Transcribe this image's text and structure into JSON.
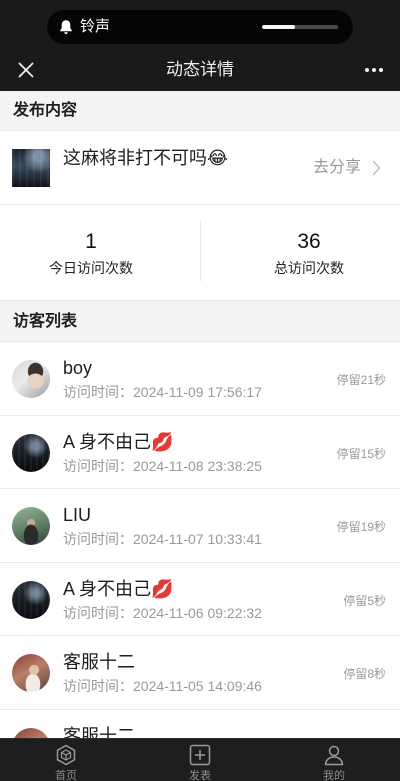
{
  "colors": {
    "bar_bg": "#1a1a1a",
    "page_bg": "#f4f4f4",
    "card_bg": "#ffffff",
    "text_primary": "#222222",
    "text_secondary": "#999999"
  },
  "status_bar": {
    "ringer_icon": "bell-icon",
    "ringer_label": "铃声",
    "ringer_level": 0.43
  },
  "nav": {
    "close_icon": "close-icon",
    "title": "动态详情",
    "more_icon": "more-icon"
  },
  "post_section": {
    "header": "发布内容",
    "text": "这麻将非打不可吗😂",
    "share_label": "去分享",
    "share_icon": "chevron-right-icon"
  },
  "stats": {
    "today": {
      "value": "1",
      "label": "今日访问次数"
    },
    "total": {
      "value": "36",
      "label": "总访问次数"
    }
  },
  "visitor_section": {
    "header": "访客列表",
    "time_label": "访问时间：",
    "visitors": [
      {
        "name": "boy",
        "time": "2024-11-09 17:56:17",
        "stay": "停留21秒"
      },
      {
        "name": "A 身不由己💋",
        "time": "2024-11-08 23:38:25",
        "stay": "停留15秒"
      },
      {
        "name": "LIU",
        "time": "2024-11-07 10:33:41",
        "stay": "停留19秒"
      },
      {
        "name": "A 身不由己💋",
        "time": "2024-11-06 09:22:32",
        "stay": "停留5秒"
      },
      {
        "name": "客服十二",
        "time": "2024-11-05 14:09:46",
        "stay": "停留8秒"
      },
      {
        "name": "客服十二"
      }
    ]
  },
  "tab_bar": {
    "items": [
      {
        "label": "首页",
        "icon": "home-icon"
      },
      {
        "label": "发表",
        "icon": "add-post-icon"
      },
      {
        "label": "我的",
        "icon": "profile-icon"
      }
    ]
  }
}
